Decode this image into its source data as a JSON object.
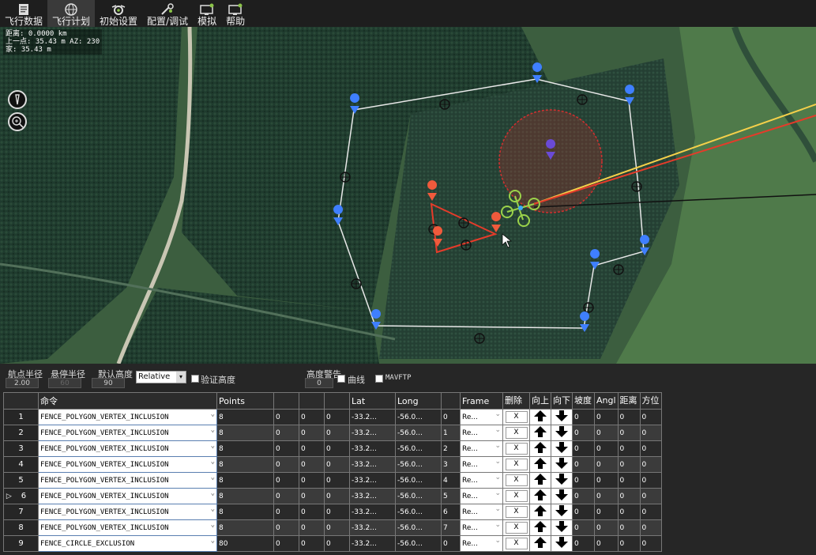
{
  "toolbar": {
    "items": [
      {
        "label": "飞行数据",
        "icon": "flight-data-icon",
        "active": false
      },
      {
        "label": "飞行计划",
        "icon": "globe-icon",
        "active": true
      },
      {
        "label": "初始设置",
        "icon": "setup-icon",
        "active": false
      },
      {
        "label": "配置/调试",
        "icon": "config-tools-icon",
        "active": false
      },
      {
        "label": "模拟",
        "icon": "simulation-icon",
        "active": false
      },
      {
        "label": "帮助",
        "icon": "help-icon",
        "active": false
      }
    ]
  },
  "map": {
    "info": {
      "distance": "距离: 0.0000 km",
      "prev_point": "上一点: 35.43 m AZ: 230",
      "home": "家: 35.43 m"
    }
  },
  "settings": {
    "waypoint_radius_label": "航点半径",
    "waypoint_radius_value": "2.00",
    "loiter_radius_label": "悬停半径",
    "loiter_radius_value": "60",
    "default_alt_label": "默认高度",
    "default_alt_value": "90",
    "alt_mode": "Relative",
    "verify_alt_label": "验证高度",
    "alt_warning_label": "高度警告",
    "alt_warning_value": "0",
    "spline_label": "曲线",
    "mavftp_label": "MAVFTP"
  },
  "grid": {
    "headers": [
      "命令",
      "Points",
      "",
      "",
      "",
      "Lat",
      "Long",
      "",
      "Frame",
      "删除",
      "向上",
      "向下",
      "坡度",
      "Angl",
      "距离",
      "方位"
    ],
    "rows": [
      {
        "num": "1",
        "cmd": "FENCE_POLYGON_VERTEX_INCLUSION",
        "points": "8",
        "p2": "0",
        "p3": "0",
        "p4": "0",
        "lat": "-33.2...",
        "long": "-56.0...",
        "alt": "0",
        "frame": "Re...",
        "del": "X",
        "grad": "0",
        "angle": "0",
        "dist": "0",
        "az": "0"
      },
      {
        "num": "2",
        "cmd": "FENCE_POLYGON_VERTEX_INCLUSION",
        "points": "8",
        "p2": "0",
        "p3": "0",
        "p4": "0",
        "lat": "-33.2...",
        "long": "-56.0...",
        "alt": "1",
        "frame": "Re...",
        "del": "X",
        "grad": "0",
        "angle": "0",
        "dist": "0",
        "az": "0"
      },
      {
        "num": "3",
        "cmd": "FENCE_POLYGON_VERTEX_INCLUSION",
        "points": "8",
        "p2": "0",
        "p3": "0",
        "p4": "0",
        "lat": "-33.2...",
        "long": "-56.0...",
        "alt": "2",
        "frame": "Re...",
        "del": "X",
        "grad": "0",
        "angle": "0",
        "dist": "0",
        "az": "0"
      },
      {
        "num": "4",
        "cmd": "FENCE_POLYGON_VERTEX_INCLUSION",
        "points": "8",
        "p2": "0",
        "p3": "0",
        "p4": "0",
        "lat": "-33.2...",
        "long": "-56.0...",
        "alt": "3",
        "frame": "Re...",
        "del": "X",
        "grad": "0",
        "angle": "0",
        "dist": "0",
        "az": "0"
      },
      {
        "num": "5",
        "cmd": "FENCE_POLYGON_VERTEX_INCLUSION",
        "points": "8",
        "p2": "0",
        "p3": "0",
        "p4": "0",
        "lat": "-33.2...",
        "long": "-56.0...",
        "alt": "4",
        "frame": "Re...",
        "del": "X",
        "grad": "0",
        "angle": "0",
        "dist": "0",
        "az": "0"
      },
      {
        "num": "6",
        "cmd": "FENCE_POLYGON_VERTEX_INCLUSION",
        "points": "8",
        "p2": "0",
        "p3": "0",
        "p4": "0",
        "lat": "-33.2...",
        "long": "-56.0...",
        "alt": "5",
        "frame": "Re...",
        "del": "X",
        "grad": "0",
        "angle": "0",
        "dist": "0",
        "az": "0"
      },
      {
        "num": "7",
        "cmd": "FENCE_POLYGON_VERTEX_INCLUSION",
        "points": "8",
        "p2": "0",
        "p3": "0",
        "p4": "0",
        "lat": "-33.2...",
        "long": "-56.0...",
        "alt": "6",
        "frame": "Re...",
        "del": "X",
        "grad": "0",
        "angle": "0",
        "dist": "0",
        "az": "0"
      },
      {
        "num": "8",
        "cmd": "FENCE_POLYGON_VERTEX_INCLUSION",
        "points": "8",
        "p2": "0",
        "p3": "0",
        "p4": "0",
        "lat": "-33.2...",
        "long": "-56.0...",
        "alt": "7",
        "frame": "Re...",
        "del": "X",
        "grad": "0",
        "angle": "0",
        "dist": "0",
        "az": "0"
      },
      {
        "num": "9",
        "cmd": "FENCE_CIRCLE_EXCLUSION",
        "points": "80",
        "p2": "0",
        "p3": "0",
        "p4": "0",
        "lat": "-33.2...",
        "long": "-56.0...",
        "alt": "0",
        "frame": "Re...",
        "del": "X",
        "grad": "0",
        "angle": "0",
        "dist": "0",
        "az": "0"
      }
    ]
  },
  "colors": {
    "fence_line": "#e8e8e8",
    "exclusion_circle": "#d32f2f",
    "marker_blue": "#3f7fff",
    "marker_red": "#f05a3c",
    "drone_green": "#9bd34a",
    "track_yellow": "#f5d04a",
    "track_red": "#e53b2a"
  }
}
